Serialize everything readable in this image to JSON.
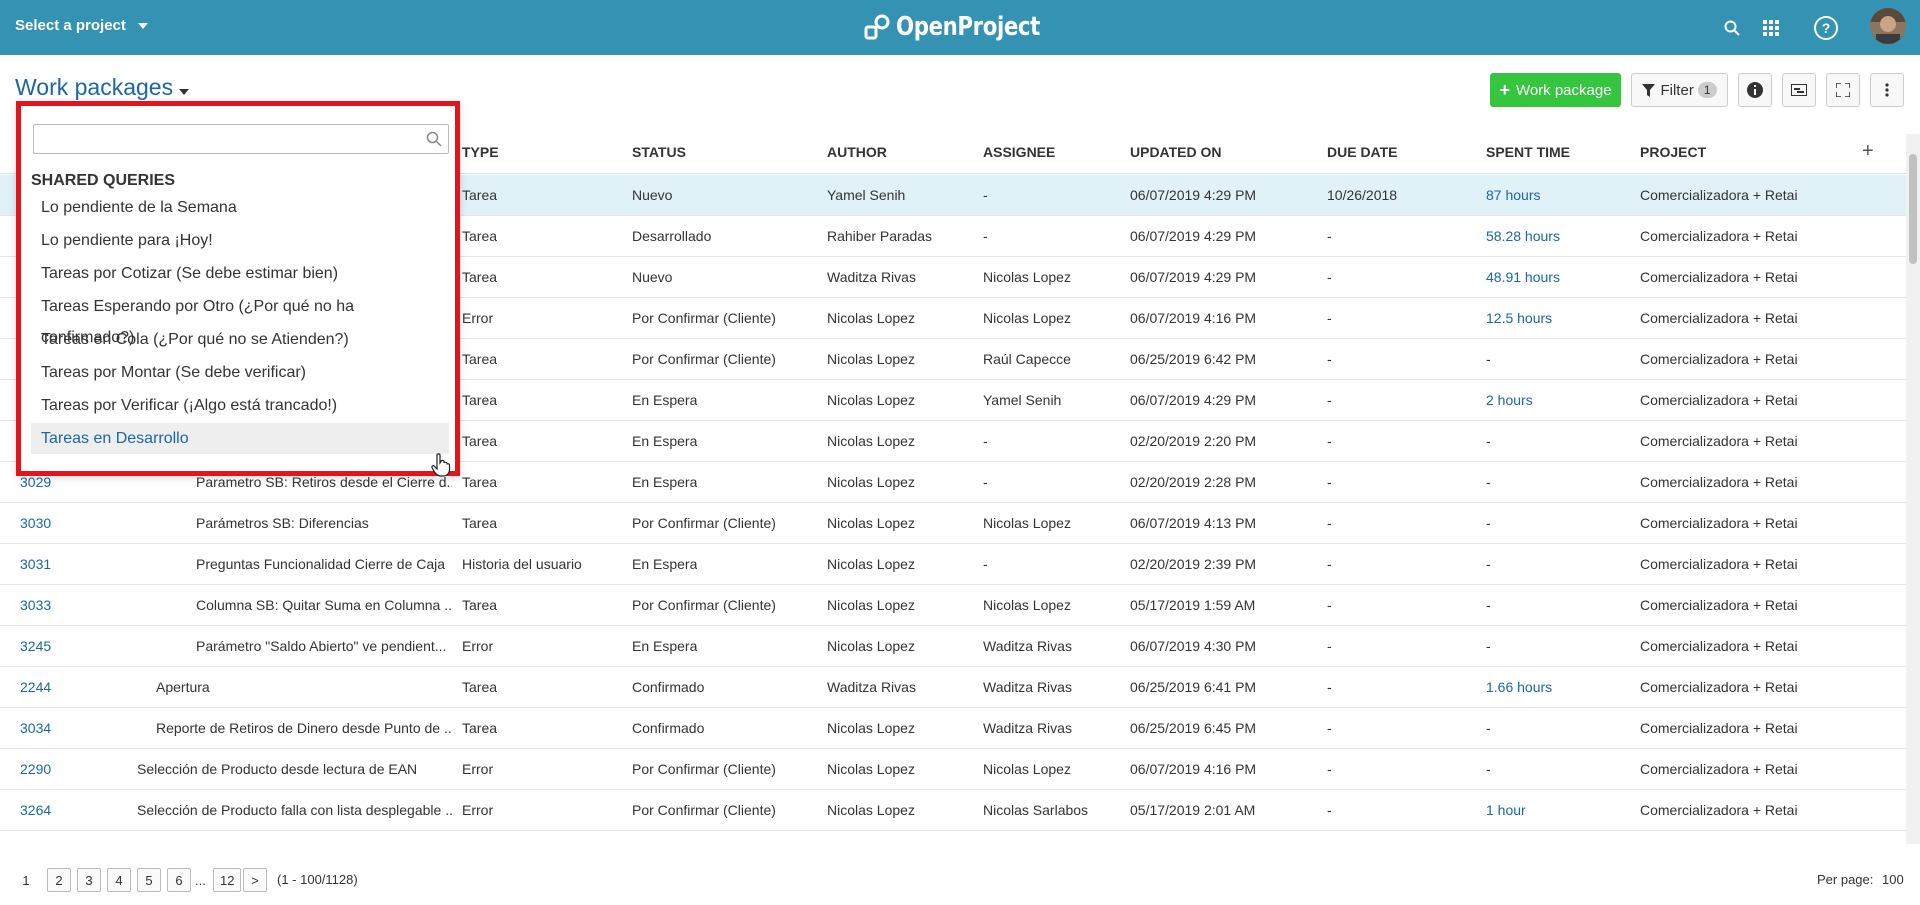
{
  "header": {
    "project_select": "Select a project",
    "logo_text": "OpenProject"
  },
  "title": "Work packages",
  "toolbar": {
    "create_label": "Work package",
    "filter_label": "Filter",
    "filter_count": "1"
  },
  "table": {
    "columns": [
      "TYPE",
      "STATUS",
      "AUTHOR",
      "ASSIGNEE",
      "UPDATED ON",
      "DUE DATE",
      "SPENT TIME",
      "PROJECT"
    ],
    "rows": [
      {
        "id": "",
        "subject": "",
        "type": "Tarea",
        "status": "Nuevo",
        "author": "Yamel Senih",
        "assignee": "-",
        "updated": "06/07/2019 4:29 PM",
        "due": "10/26/2018",
        "spent": "87 hours",
        "project": "Comercializadora + Retai"
      },
      {
        "id": "",
        "subject": "",
        "type": "Tarea",
        "status": "Desarrollado",
        "author": "Rahiber Paradas",
        "assignee": "-",
        "updated": "06/07/2019 4:29 PM",
        "due": "-",
        "spent": "58.28 hours",
        "project": "Comercializadora + Retai"
      },
      {
        "id": "",
        "subject": "",
        "type": "Tarea",
        "status": "Nuevo",
        "author": "Waditza Rivas",
        "assignee": "Nicolas Lopez",
        "updated": "06/07/2019 4:29 PM",
        "due": "-",
        "spent": "48.91 hours",
        "project": "Comercializadora + Retai"
      },
      {
        "id": "",
        "subject": "",
        "type": "Error",
        "status": "Por Confirmar (Cliente)",
        "author": "Nicolas Lopez",
        "assignee": "Nicolas Lopez",
        "updated": "06/07/2019 4:16 PM",
        "due": "-",
        "spent": "12.5 hours",
        "project": "Comercializadora + Retai"
      },
      {
        "id": "",
        "subject": "",
        "type": "Tarea",
        "status": "Por Confirmar (Cliente)",
        "author": "Nicolas Lopez",
        "assignee": "Raúl Capecce",
        "updated": "06/25/2019 6:42 PM",
        "due": "-",
        "spent": "-",
        "project": "Comercializadora + Retai"
      },
      {
        "id": "",
        "subject": "",
        "type": "Tarea",
        "status": "En Espera",
        "author": "Nicolas Lopez",
        "assignee": "Yamel Senih",
        "updated": "06/07/2019 4:29 PM",
        "due": "-",
        "spent": "2 hours",
        "project": "Comercializadora + Retai"
      },
      {
        "id": "",
        "subject": "",
        "type": "Tarea",
        "status": "En Espera",
        "author": "Nicolas Lopez",
        "assignee": "-",
        "updated": "02/20/2019 2:20 PM",
        "due": "-",
        "spent": "-",
        "project": "Comercializadora + Retai"
      },
      {
        "id": "3029",
        "subject": "Parametro SB: Retiros desde el Cierre d...",
        "type": "Tarea",
        "status": "En Espera",
        "author": "Nicolas Lopez",
        "assignee": "-",
        "updated": "02/20/2019 2:28 PM",
        "due": "-",
        "spent": "-",
        "project": "Comercializadora + Retai"
      },
      {
        "id": "3030",
        "subject": "Parámetros SB: Diferencias",
        "type": "Tarea",
        "status": "Por Confirmar (Cliente)",
        "author": "Nicolas Lopez",
        "assignee": "Nicolas Lopez",
        "updated": "06/07/2019 4:13 PM",
        "due": "-",
        "spent": "-",
        "project": "Comercializadora + Retai"
      },
      {
        "id": "3031",
        "subject": "Preguntas Funcionalidad Cierre de Caja",
        "type": "Historia del usuario",
        "status": "En Espera",
        "author": "Nicolas Lopez",
        "assignee": "-",
        "updated": "02/20/2019 2:39 PM",
        "due": "-",
        "spent": "-",
        "project": "Comercializadora + Retai"
      },
      {
        "id": "3033",
        "subject": "Columna SB: Quitar Suma en Columna ...",
        "type": "Tarea",
        "status": "Por Confirmar (Cliente)",
        "author": "Nicolas Lopez",
        "assignee": "Nicolas Lopez",
        "updated": "05/17/2019 1:59 AM",
        "due": "-",
        "spent": "-",
        "project": "Comercializadora + Retai"
      },
      {
        "id": "3245",
        "subject": "Parámetro \"Saldo Abierto\" ve pendient...",
        "type": "Error",
        "status": "En Espera",
        "author": "Nicolas Lopez",
        "assignee": "Waditza Rivas",
        "updated": "06/07/2019 4:30 PM",
        "due": "-",
        "spent": "-",
        "project": "Comercializadora + Retai"
      },
      {
        "id": "2244",
        "subject": "Apertura",
        "type": "Tarea",
        "status": "Confirmado",
        "author": "Waditza Rivas",
        "assignee": "Waditza Rivas",
        "updated": "06/25/2019 6:41 PM",
        "due": "-",
        "spent": "1.66 hours",
        "project": "Comercializadora + Retai"
      },
      {
        "id": "3034",
        "subject": "Reporte de Retiros de Dinero desde Punto de ...",
        "type": "Tarea",
        "status": "Confirmado",
        "author": "Nicolas Lopez",
        "assignee": "Waditza Rivas",
        "updated": "06/25/2019 6:45 PM",
        "due": "-",
        "spent": "-",
        "project": "Comercializadora + Retai"
      },
      {
        "id": "2290",
        "subject": "Selección de Producto desde lectura de EAN",
        "type": "Error",
        "status": "Por Confirmar (Cliente)",
        "author": "Nicolas Lopez",
        "assignee": "Nicolas Lopez",
        "updated": "06/07/2019 4:16 PM",
        "due": "-",
        "spent": "-",
        "project": "Comercializadora + Retai"
      },
      {
        "id": "3264",
        "subject": "Selección de Producto falla con lista desplegable ...",
        "type": "Error",
        "status": "Por Confirmar (Cliente)",
        "author": "Nicolas Lopez",
        "assignee": "Nicolas Sarlabos",
        "updated": "05/17/2019 2:01 AM",
        "due": "-",
        "spent": "1 hour",
        "project": "Comercializadora + Retai"
      }
    ]
  },
  "dropdown": {
    "search_value": "",
    "heading": "SHARED QUERIES",
    "items": [
      "Lo pendiente de la Semana",
      "Lo pendiente para ¡Hoy!",
      "Tareas por Cotizar (Se debe estimar bien)",
      "Tareas Esperando por Otro (¿Por qué no ha confirmado?)",
      "Tareas en Cola (¿Por qué no se Atienden?)",
      "Tareas por Montar (Se debe verificar)",
      "Tareas por Verificar (¡Algo está trancado!)",
      "Tareas en Desarrollo"
    ],
    "active_index": 7
  },
  "pagination": {
    "pages": [
      "1",
      "2",
      "3",
      "4",
      "5",
      "6",
      "...",
      "12",
      ">"
    ],
    "info": "(1 - 100/1128)",
    "per_page_label": "Per page:",
    "per_page_value": "100"
  },
  "colors": {
    "header_bg": "#3493b3",
    "link": "#1a67a3",
    "create_button": "#35c53f",
    "highlight_border": "#e3141c"
  }
}
